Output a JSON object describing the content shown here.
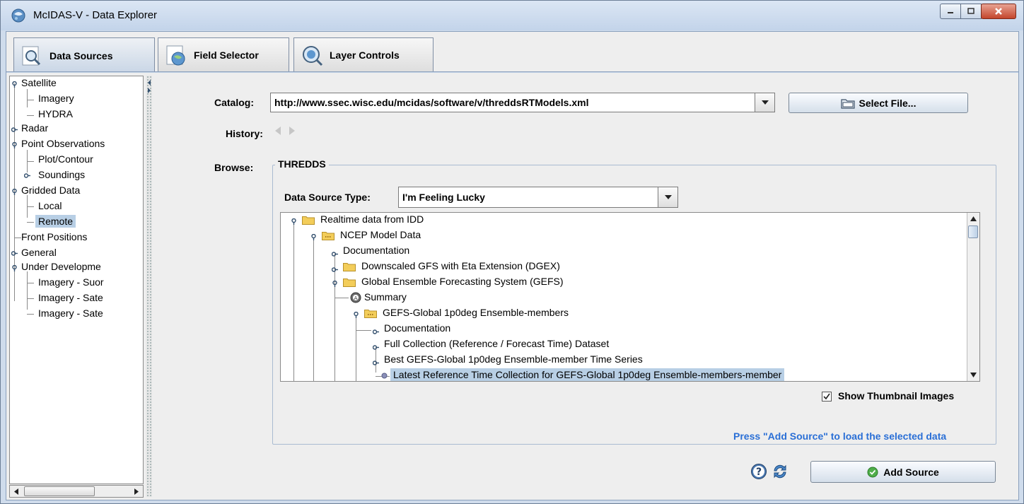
{
  "window": {
    "title": "McIDAS-V - Data Explorer"
  },
  "tabs": [
    {
      "label": "Data Sources",
      "active": true
    },
    {
      "label": "Field Selector",
      "active": false
    },
    {
      "label": "Layer Controls",
      "active": false
    }
  ],
  "left_tree": {
    "items": [
      {
        "label": "Satellite"
      },
      {
        "label": "Imagery"
      },
      {
        "label": "HYDRA"
      },
      {
        "label": "Radar"
      },
      {
        "label": "Point Observations"
      },
      {
        "label": "Plot/Contour"
      },
      {
        "label": "Soundings"
      },
      {
        "label": "Gridded Data"
      },
      {
        "label": "Local"
      },
      {
        "label": "Remote",
        "selected": true
      },
      {
        "label": "Front Positions"
      },
      {
        "label": "General"
      },
      {
        "label": "Under Developme"
      },
      {
        "label": "Imagery - Suor"
      },
      {
        "label": "Imagery - Sate"
      },
      {
        "label": "Imagery - Sate"
      }
    ]
  },
  "form": {
    "catalog_label": "Catalog:",
    "catalog_value": "http://www.ssec.wisc.edu/mcidas/software/v/threddsRTModels.xml",
    "select_file_label": "Select File...",
    "history_label": "History:",
    "browse_label": "Browse:",
    "group_title": "THREDDS",
    "data_source_type_label": "Data Source Type:",
    "data_source_type_value": "I'm Feeling Lucky",
    "show_thumbnails_label": "Show Thumbnail Images",
    "show_thumbnails_checked": true,
    "hint": "Press \"Add Source\" to load the selected data",
    "add_source_label": "Add Source"
  },
  "ds_tree": {
    "items": [
      {
        "label": "Realtime data from IDD"
      },
      {
        "label": "NCEP Model Data"
      },
      {
        "label": "Documentation"
      },
      {
        "label": "Downscaled GFS with Eta Extension (DGEX)"
      },
      {
        "label": "Global Ensemble Forecasting System (GEFS)"
      },
      {
        "label": "Summary"
      },
      {
        "label": "GEFS-Global 1p0deg Ensemble-members"
      },
      {
        "label": "Documentation"
      },
      {
        "label": "Full Collection (Reference / Forecast Time) Dataset"
      },
      {
        "label": "Best GEFS-Global 1p0deg Ensemble-member Time Series"
      },
      {
        "label": "Latest Reference Time Collection for GEFS-Global 1p0deg Ensemble-members-member",
        "selected": true
      }
    ]
  },
  "colors": {
    "selection": "#b8cfe5",
    "hint_text": "#2a6fd6",
    "folder": "#f3cd5a"
  }
}
